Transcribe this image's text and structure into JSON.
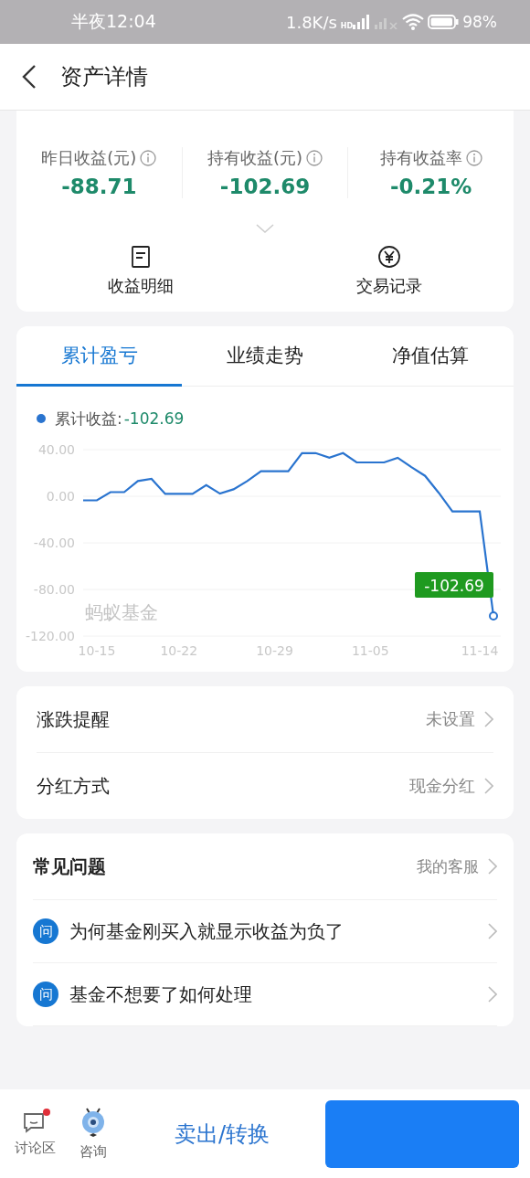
{
  "status_bar": {
    "time": "半夜12:04",
    "net_speed": "1.8K/s",
    "signal_label": "HD",
    "battery": "98%"
  },
  "header": {
    "title": "资产详情"
  },
  "summary": {
    "metrics": [
      {
        "label": "昨日收益(元)",
        "value": "-88.71"
      },
      {
        "label": "持有收益(元)",
        "value": "-102.69"
      },
      {
        "label": "持有收益率",
        "value": "-0.21%"
      }
    ],
    "expanded": false,
    "actions": [
      {
        "kind": "document",
        "label": "收益明细"
      },
      {
        "kind": "yen",
        "label": "交易记录"
      }
    ]
  },
  "tabs": [
    {
      "label": "累计盈亏",
      "selected": true
    },
    {
      "label": "业绩走势",
      "selected": false
    },
    {
      "label": "净值估算",
      "selected": false
    }
  ],
  "chart": {
    "legend_value": "-102.69",
    "watermark": "蚂蚁基金",
    "chart_data": {
      "type": "line",
      "categories": [
        null,
        "10-15",
        null,
        null,
        null,
        null,
        null,
        "10-22",
        null,
        null,
        null,
        null,
        null,
        null,
        "10-29",
        null,
        null,
        null,
        null,
        null,
        null,
        "11-05",
        null,
        null,
        null,
        null,
        null,
        null,
        null,
        "11-14",
        null
      ],
      "series": [
        {
          "name": "累计收益:",
          "color": "#2a74cf",
          "values": [
            -3.5,
            -3.5,
            3.5,
            3.5,
            13,
            15,
            2,
            2,
            2,
            9.5,
            2.3,
            6,
            13,
            21.5,
            21.5,
            21.5,
            37,
            37,
            33,
            37,
            29,
            29,
            29,
            33,
            25,
            17.5,
            3,
            -13,
            -13,
            -13,
            -102.69
          ]
        }
      ],
      "ylim": [
        -120,
        40
      ],
      "yticks": [
        {
          "value": 40,
          "label": "40.00"
        },
        {
          "value": 0,
          "label": "0.00"
        },
        {
          "value": -40,
          "label": "-40.00"
        },
        {
          "value": -80,
          "label": "-80.00"
        },
        {
          "value": -120,
          "label": "-120.00"
        }
      ],
      "grid": true,
      "annotations": [
        "-102.69"
      ]
    }
  },
  "settings": [
    {
      "label": "涨跌提醒",
      "value": "未设置"
    },
    {
      "label": "分红方式",
      "value": "现金分红"
    }
  ],
  "faq": {
    "title": "常见问题",
    "link": "我的客服",
    "items": [
      {
        "badge": "问",
        "text": "为何基金刚买入就显示收益为负了"
      },
      {
        "badge": "问",
        "text": "基金不想要了如何处理"
      }
    ]
  },
  "bottom_bar": {
    "items": [
      {
        "kind": "chat",
        "label": "讨论区",
        "badge": true
      },
      {
        "kind": "mascot",
        "label": "咨询",
        "badge": false
      }
    ],
    "sell_button": "卖出/转换"
  }
}
